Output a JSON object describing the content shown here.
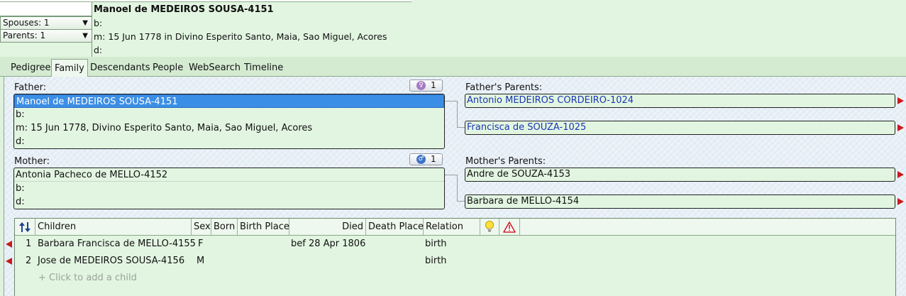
{
  "header": {
    "spouses_label": "Spouses: 1",
    "parents_label": "Parents: 1",
    "person_name": "Manoel de MEDEIROS SOUSA-4151",
    "birth": "b:",
    "marriage": "m: 15 Jun 1778 in Divino Esperito Santo, Maia, Sao Miguel, Acores",
    "death": "d:"
  },
  "tabs": [
    {
      "label": "Pedigree",
      "active": false
    },
    {
      "label": "Family",
      "active": true
    },
    {
      "label": "Descendants",
      "active": false
    },
    {
      "label": "People",
      "active": false
    },
    {
      "label": "WebSearch",
      "active": false
    },
    {
      "label": "Timeline",
      "active": false
    }
  ],
  "family": {
    "father": {
      "section_label": "Father:",
      "badge_count": "1",
      "name": "Manoel de MEDEIROS SOUSA-4151",
      "birth": "b:",
      "marriage": "m: 15 Jun 1778, Divino Esperito Santo, Maia, Sao Miguel, Acores",
      "death": "d:"
    },
    "mother": {
      "section_label": "Mother:",
      "badge_count": "1",
      "name": "Antonia Pacheco de MELLO-4152",
      "birth": "b:",
      "death": "d:"
    },
    "fathers_parents": {
      "section_label": "Father's Parents:",
      "father": "Antonio MEDEIROS CORDEIRO-1024",
      "mother": "Francisca de SOUZA-1025"
    },
    "mothers_parents": {
      "section_label": "Mother's Parents:",
      "father": "Andre de SOUZA-4153",
      "mother": "Barbara de MELLO-4154"
    }
  },
  "children_grid": {
    "columns": [
      "Children",
      "Sex",
      "Born",
      "Birth Place",
      "Died",
      "Death Place",
      "Relation"
    ],
    "rows": [
      {
        "num": "1",
        "name": "Barbara Francisca de MELLO-4155",
        "sex": "F",
        "born": "",
        "birth_place": "",
        "died": "bef 28 Apr 1806",
        "death_place": "",
        "relation": "birth"
      },
      {
        "num": "2",
        "name": "Jose de MEDEIROS SOUSA-4156",
        "sex": "M",
        "born": "",
        "birth_place": "",
        "died": "",
        "death_place": "",
        "relation": "birth"
      }
    ],
    "add_child_label": "+ Click to add a child"
  },
  "icons": {
    "sort": "sort-updown-icon",
    "hint": "lightbulb-icon",
    "warning": "warning-icon",
    "father_badge": "male-person-icon",
    "mother_badge": "female-person-icon"
  },
  "colors": {
    "selected": "#3b8ee5",
    "link": "#1a37b5",
    "accent_arrow": "#c81a1a",
    "panel_green": "#e2f5e1"
  }
}
